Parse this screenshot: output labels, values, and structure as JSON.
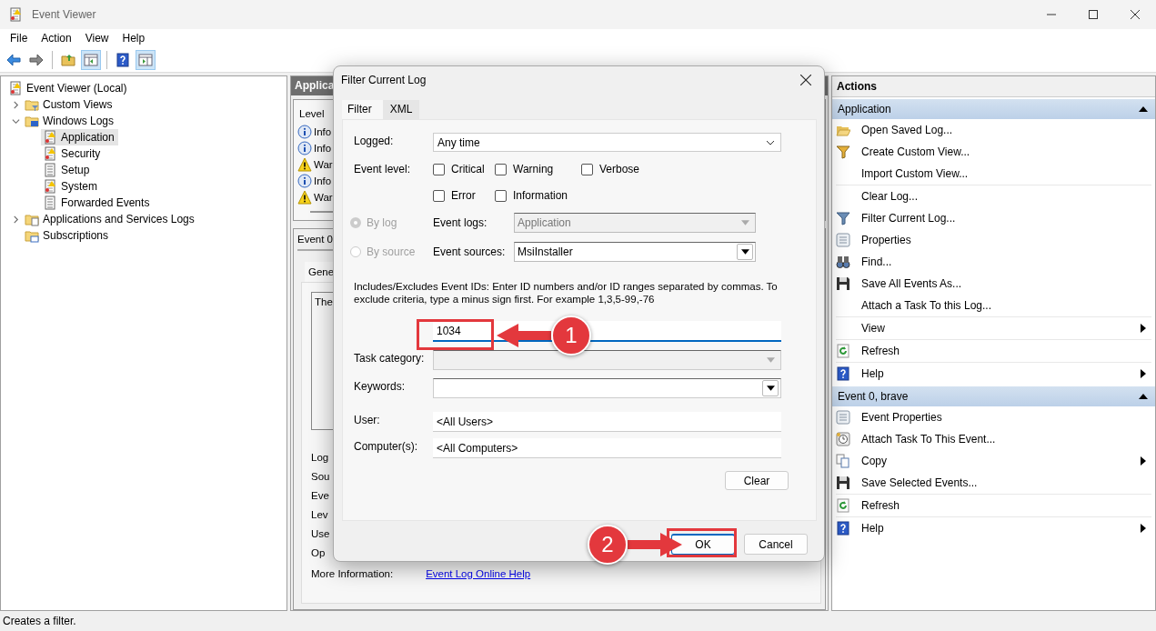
{
  "window": {
    "title": "Event Viewer"
  },
  "window_controls": [
    {
      "kind": "minimize"
    },
    {
      "kind": "maximize"
    },
    {
      "kind": "close"
    }
  ],
  "menu": [
    "File",
    "Action",
    "View",
    "Help"
  ],
  "toolbar": [
    {
      "kind": "back",
      "pressed": false
    },
    {
      "kind": "forward",
      "pressed": false
    },
    {
      "kind": "folder-up",
      "pressed": false
    },
    {
      "kind": "pane",
      "pressed": true
    },
    {
      "kind": "help",
      "pressed": false
    },
    {
      "kind": "pane-right",
      "pressed": true
    }
  ],
  "tree": [
    {
      "label": "Event Viewer (Local)",
      "selected": false,
      "children": [
        {
          "label": "Custom Views",
          "expanded": false,
          "selected": false
        },
        {
          "label": "Windows Logs",
          "expanded": true,
          "selected": false,
          "children": [
            {
              "label": "Application",
              "selected": true
            },
            {
              "label": "Security",
              "selected": false
            },
            {
              "label": "Setup",
              "selected": false
            },
            {
              "label": "System",
              "selected": false
            },
            {
              "label": "Forwarded Events",
              "selected": false
            }
          ]
        },
        {
          "label": "Applications and Services Logs",
          "expanded": false,
          "selected": false
        },
        {
          "label": "Subscriptions",
          "selected": false
        }
      ]
    }
  ],
  "middle": {
    "header": "Applica",
    "list_header": "Level",
    "rows": [
      {
        "kind": "info",
        "text": "Info"
      },
      {
        "kind": "info",
        "text": "Info"
      },
      {
        "kind": "warning",
        "text": "War"
      },
      {
        "kind": "info",
        "text": "Info"
      },
      {
        "kind": "warning",
        "text": "War"
      }
    ],
    "details_header": "Event 0",
    "details_tab": "Gene",
    "description": "The",
    "fields": [
      "Log",
      "Sou",
      "Eve",
      "Lev",
      "Use",
      "Op"
    ],
    "more_label": "More Information:",
    "more_link": "Event Log Online Help"
  },
  "dialog": {
    "title": "Filter Current Log",
    "tabs": [
      {
        "label": "Filter",
        "selected": true
      },
      {
        "label": "XML",
        "selected": false
      }
    ],
    "logged": {
      "label": "Logged:",
      "value": "Any time"
    },
    "event_level": {
      "label": "Event level:",
      "options": [
        {
          "label": "Critical",
          "checked": false
        },
        {
          "label": "Warning",
          "checked": false
        },
        {
          "label": "Verbose",
          "checked": false
        },
        {
          "label": "Error",
          "checked": false
        },
        {
          "label": "Information",
          "checked": false
        }
      ]
    },
    "sources": [
      {
        "radio": "By log",
        "selected": true,
        "disabled": true,
        "label": "Event logs:",
        "value": "Application",
        "field_disabled": true
      },
      {
        "radio": "By source",
        "selected": false,
        "disabled": true,
        "label": "Event sources:",
        "value": "MsiInstaller",
        "field_disabled": false
      }
    ],
    "ids_help": "Includes/Excludes Event IDs: Enter ID numbers and/or ID ranges separated by commas. To exclude criteria, type a minus sign first. For example 1,3,5-99,-76",
    "ids_value": "1034",
    "task_category": {
      "label": "Task category:",
      "disabled": true
    },
    "keywords": {
      "label": "Keywords:",
      "disabled": false
    },
    "user": {
      "label": "User:",
      "value": "<All Users>"
    },
    "computer": {
      "label": "Computer(s):",
      "value": "<All Computers>"
    },
    "buttons": {
      "clear": "Clear",
      "ok": "OK",
      "cancel": "Cancel"
    }
  },
  "actions": {
    "title": "Actions",
    "sections": [
      {
        "title": "Application",
        "expanded": true,
        "groups": [
          [
            {
              "label": "Open Saved Log...",
              "submenu": false
            },
            {
              "label": "Create Custom View...",
              "submenu": false
            },
            {
              "label": "Import Custom View...",
              "submenu": false
            }
          ],
          [
            {
              "label": "Clear Log...",
              "submenu": false
            },
            {
              "label": "Filter Current Log...",
              "submenu": false
            },
            {
              "label": "Properties",
              "submenu": false
            },
            {
              "label": "Find...",
              "submenu": false
            },
            {
              "label": "Save All Events As...",
              "submenu": false
            },
            {
              "label": "Attach a Task To this Log...",
              "submenu": false
            }
          ],
          [
            {
              "label": "View",
              "submenu": true
            }
          ],
          [
            {
              "label": "Refresh",
              "submenu": false
            }
          ],
          [
            {
              "label": "Help",
              "submenu": true
            }
          ]
        ]
      },
      {
        "title": "Event 0, brave",
        "expanded": true,
        "groups": [
          [
            {
              "label": "Event Properties",
              "submenu": false
            },
            {
              "label": "Attach Task To This Event...",
              "submenu": false
            },
            {
              "label": "Copy",
              "submenu": true
            },
            {
              "label": "Save Selected Events...",
              "submenu": false
            }
          ],
          [
            {
              "label": "Refresh",
              "submenu": false
            }
          ],
          [
            {
              "label": "Help",
              "submenu": true
            }
          ]
        ]
      }
    ]
  },
  "annotations": [
    {
      "number": "1"
    },
    {
      "number": "2"
    }
  ],
  "status_bar": "Creates a filter."
}
